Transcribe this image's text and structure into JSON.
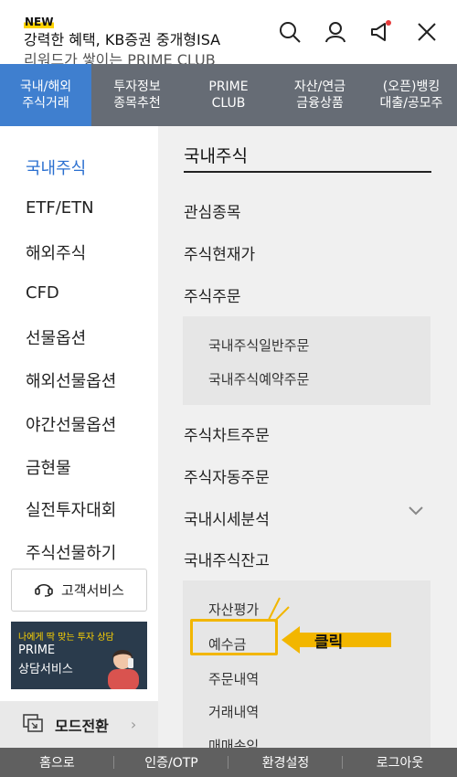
{
  "header": {
    "new_badge": "NEW",
    "ticker_line1": "강력한 혜택, KB증권 중개형ISA",
    "ticker_line2": "리워드가 쌓이는 PRIME CLUB",
    "icons": [
      "search-icon",
      "user-icon",
      "megaphone-icon",
      "close-icon"
    ],
    "notification_color": "#e63b3b"
  },
  "topnav": {
    "tabs": [
      {
        "label": "국내/해외\n주식거래",
        "active": true
      },
      {
        "label": "투자정보\n종목추천",
        "active": false
      },
      {
        "label": "PRIME\nCLUB",
        "active": false
      },
      {
        "label": "자산/연금\n금융상품",
        "active": false
      },
      {
        "label": "(오픈)뱅킹\n대출/공모주",
        "active": false
      }
    ],
    "active_color": "#3f7fcf",
    "bg_color": "#666c75"
  },
  "leftmenu": {
    "items": [
      {
        "label": "국내주식",
        "active": true
      },
      {
        "label": "ETF/ETN",
        "active": false
      },
      {
        "label": "해외주식",
        "active": false
      },
      {
        "label": "CFD",
        "active": false
      },
      {
        "label": "선물옵션",
        "active": false
      },
      {
        "label": "해외선물옵션",
        "active": false
      },
      {
        "label": "야간선물옵션",
        "active": false
      },
      {
        "label": "금현물",
        "active": false
      },
      {
        "label": "실전투자대회",
        "active": false
      },
      {
        "label": "주식선물하기",
        "active": false
      }
    ],
    "customer_service": "고객서비스",
    "prime_banner": {
      "subtitle": "나에게 딱 맞는 투자 상담",
      "line1": "PRIME",
      "line2": "상담서비스"
    },
    "mode_switch": "모드전환"
  },
  "rightarea": {
    "title": "국내주식",
    "items": [
      "관심종목",
      "주식현재가",
      "주식주문"
    ],
    "order_sub": [
      "국내주식일반주문",
      "국내주식예약주문"
    ],
    "items2": [
      "주식차트주문",
      "주식자동주문",
      "국내시세분석",
      "국내주식잔고"
    ],
    "balance_sub": [
      "자산평가",
      "예수금",
      "주문내역",
      "거래내역",
      "매매손익"
    ]
  },
  "annotation": {
    "click_label": "클릭",
    "highlight_color": "#f2b600"
  },
  "footer": {
    "items": [
      "홈으로",
      "인증/OTP",
      "환경설정",
      "로그아웃"
    ]
  }
}
